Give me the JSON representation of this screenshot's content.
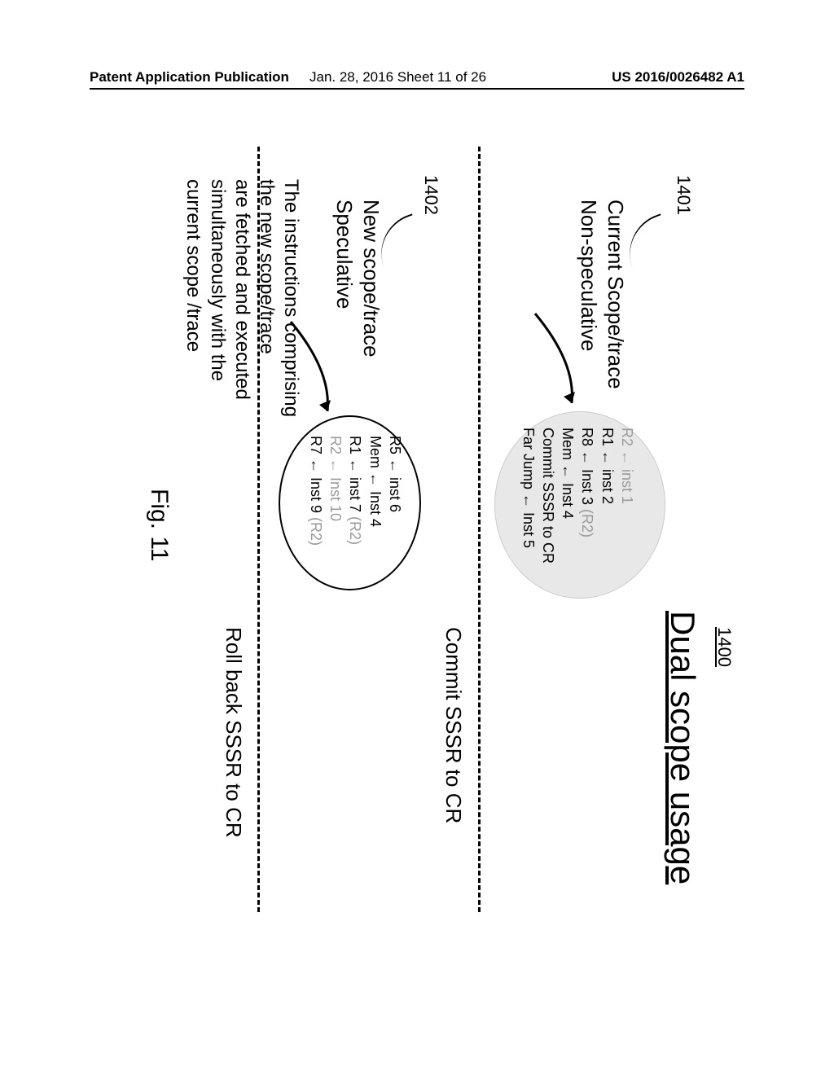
{
  "header": {
    "left": "Patent Application Publication",
    "middle": "Jan. 28, 2016   Sheet 11 of 26",
    "right": "US 2016/0026482 A1"
  },
  "figure": {
    "main_title": "Dual scope usage",
    "ref_1400": "1400",
    "ref_1401": "1401",
    "ref_1402": "1402",
    "current_scope_l1": "Current Scope/trace",
    "current_scope_l2": "Non-speculative",
    "new_scope_l1": "New scope/trace",
    "new_scope_l2": "Speculative",
    "bubble1": {
      "l1a": "R2 ← inst 1",
      "l2": "R1 ← inst 2",
      "l3a": "R8 ← Inst 3 ",
      "l3b": "(R2)",
      "l4": "Mem ← Inst 4",
      "l5": "Commit SSSR to CR",
      "l6": "Far Jump ← Inst 5"
    },
    "commit_text": "Commit SSSR to CR",
    "bubble2": {
      "l1": "R5 ← inst 6",
      "l2": "Mem ← Inst 4",
      "l3a": "R1 ← inst 7 ",
      "l3b": "(R2)",
      "l4a": "R2 ← Inst 10",
      "l5a": "R7 ← Inst 9 ",
      "l5b": "(R2)"
    },
    "rollback_text": "Roll back SSSR to CR",
    "explain_l1": "The instructions comprising",
    "explain_l2": "the new scope/trace",
    "explain_l3": "are fetched and executed",
    "explain_l4": "simultaneously with the",
    "explain_l5": "current scope /trace",
    "fig_label": "Fig. 11"
  }
}
